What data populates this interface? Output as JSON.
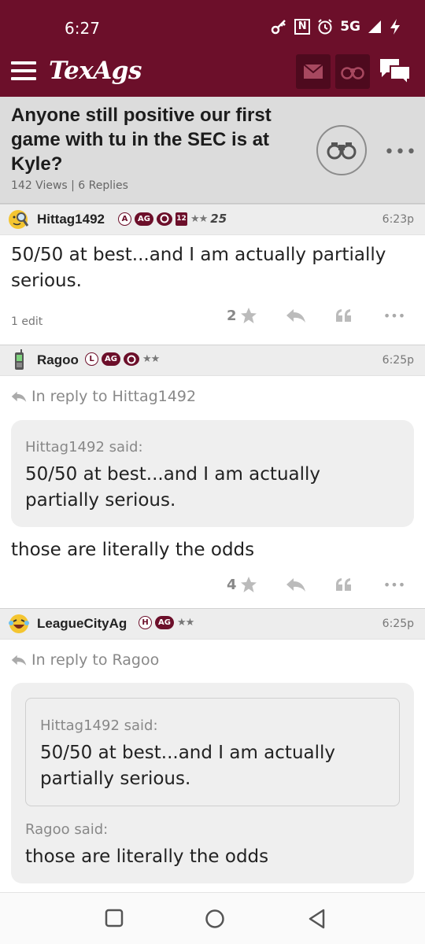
{
  "status_bar": {
    "time": "6:27",
    "network": "5G"
  },
  "app_bar": {
    "logo": "TexAgs",
    "icons": [
      "menu-icon",
      "mail-icon",
      "binoculars-icon",
      "chat-icon"
    ],
    "brand_color": "#6c0f2a"
  },
  "thread": {
    "title": "Anyone still positive our first game with tu in the SEC is at Kyle?",
    "meta": "142 Views | 6 Replies"
  },
  "posts": [
    {
      "username": "Hittag1492",
      "badges": [
        "A",
        "AG",
        "12",
        "★★",
        "25"
      ],
      "time": "6:23p",
      "body": "50/50 at best...and I am actually partially serious.",
      "edit_note": "1 edit",
      "star_count": "2"
    },
    {
      "username": "Ragoo",
      "badges": [
        "L",
        "AG",
        "★★"
      ],
      "time": "6:25p",
      "reply_to": "In reply to Hittag1492",
      "quote": {
        "by": "Hittag1492 said:",
        "text": "50/50 at best...and I am actually partially serious."
      },
      "body": "those are literally the odds",
      "star_count": "4"
    },
    {
      "username": "LeagueCityAg",
      "badges": [
        "H",
        "AG",
        "★★"
      ],
      "time": "6:25p",
      "reply_to": "In reply to Ragoo",
      "nested_quote": {
        "by": "Hittag1492 said:",
        "text": "50/50 at best...and I am actually partially serious."
      },
      "quote": {
        "by": "Ragoo said:",
        "text": "those are literally the odds"
      }
    }
  ]
}
